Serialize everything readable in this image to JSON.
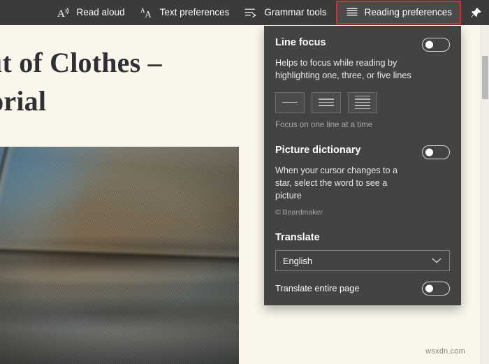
{
  "toolbar": {
    "items": [
      {
        "id": "read-aloud",
        "label": "Read aloud",
        "icon": "read-aloud-icon"
      },
      {
        "id": "text-preferences",
        "label": "Text preferences",
        "icon": "text-preferences-icon"
      },
      {
        "id": "grammar-tools",
        "label": "Grammar tools",
        "icon": "grammar-tools-icon"
      },
      {
        "id": "reading-preferences",
        "label": "Reading preferences",
        "icon": "reading-preferences-icon"
      }
    ],
    "pin_icon": "pin-icon",
    "highlight_color": "#e8262b",
    "background_color": "#3b3b3b"
  },
  "panel": {
    "line_focus": {
      "title": "Line focus",
      "description": "Helps to focus while reading by highlighting one, three, or five lines",
      "toggle_state": "off",
      "options": [
        {
          "id": "one-line",
          "lines": 1
        },
        {
          "id": "three-line",
          "lines": 3
        },
        {
          "id": "five-line",
          "lines": 5
        }
      ],
      "caption": "Focus on one line at a time"
    },
    "picture_dictionary": {
      "title": "Picture dictionary",
      "description": "When your cursor changes to a star, select the word to see a picture",
      "credit": "© Boardmaker",
      "toggle_state": "off"
    },
    "translate": {
      "title": "Translate",
      "language_value": "English",
      "chevron": "chevron-down-icon",
      "entire_page_label": "Translate entire page",
      "entire_page_toggle_state": "off"
    },
    "background_color": "#434343"
  },
  "page": {
    "article_title": "t Out of Clothes – Tutorial",
    "watermark": "wsxdn.com",
    "background_color": "#faf6ec",
    "hero_image_alt": "close-up photograph of worn denim jeans fabric and seam"
  }
}
